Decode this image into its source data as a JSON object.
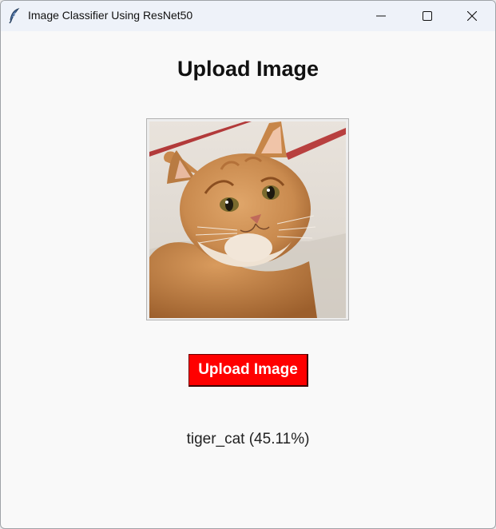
{
  "window": {
    "title": "Image Classifier Using ResNet50",
    "app_icon": "feather-icon",
    "controls": [
      "minimize-icon",
      "maximize-icon",
      "close-icon"
    ]
  },
  "main": {
    "heading": "Upload Image",
    "preview_image": "orange tabby cat photo",
    "upload_button_label": "Upload Image",
    "prediction": "tiger_cat (45.11%)"
  },
  "colors": {
    "titlebar": "#eef2f9",
    "background": "#f9f9f9",
    "button": "#ff0000",
    "button_text": "#ffffff"
  }
}
